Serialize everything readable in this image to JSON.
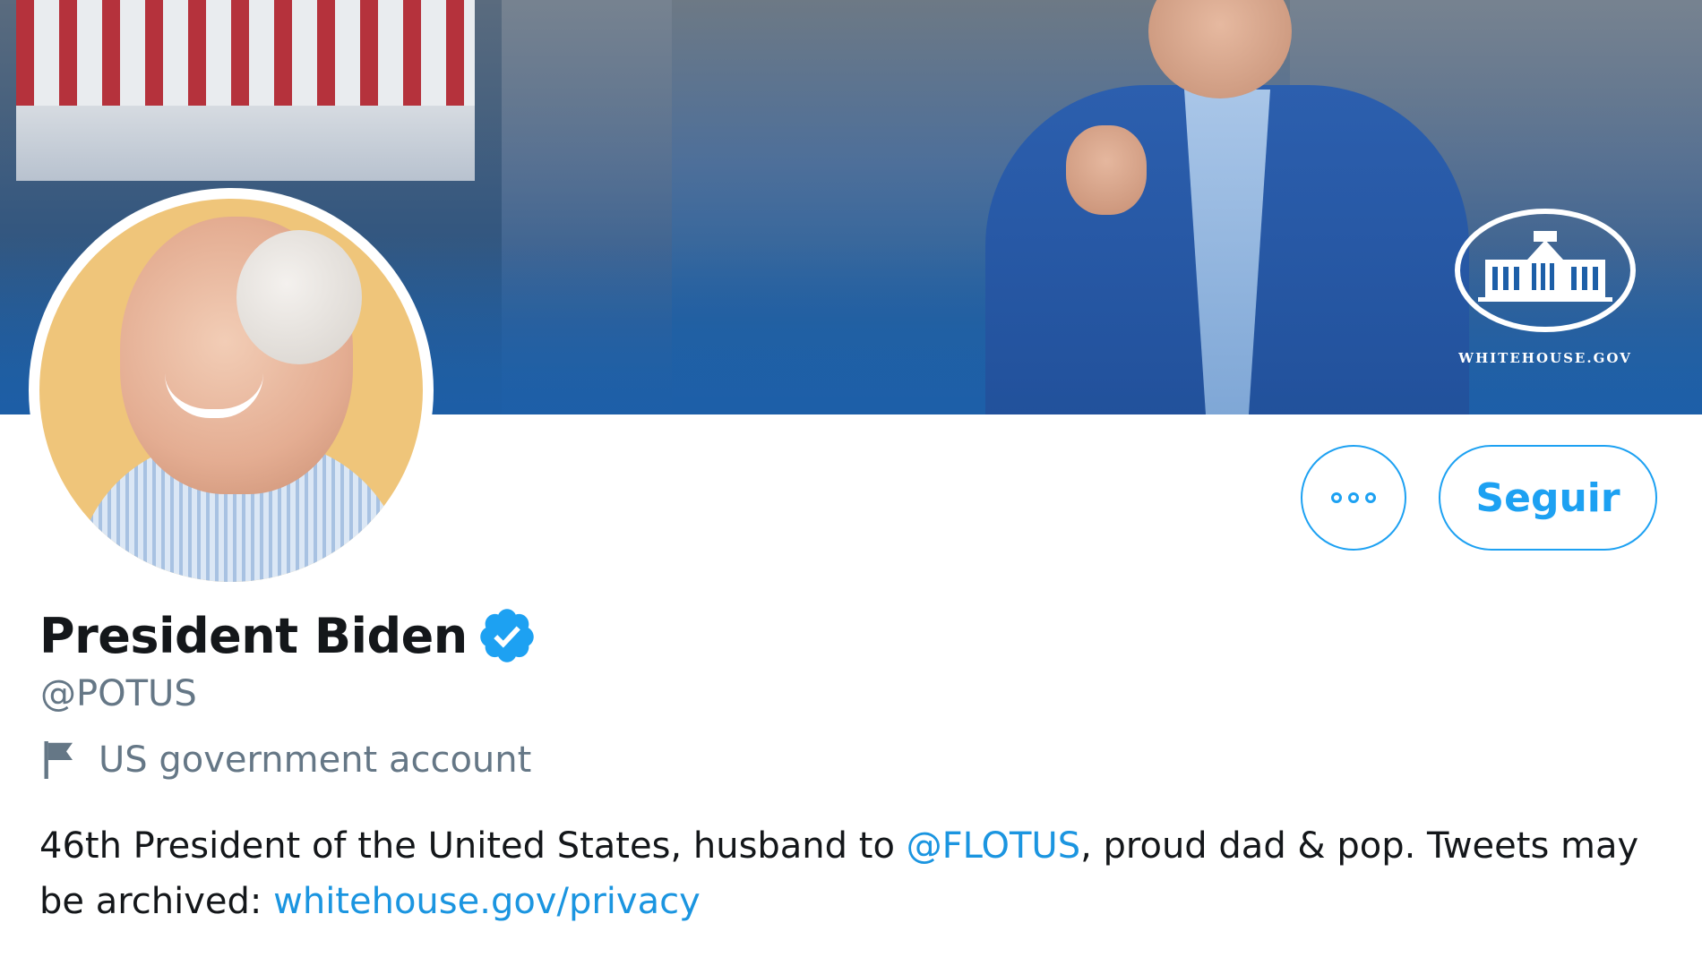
{
  "banner": {
    "logo_text": "WHITEHOUSE.GOV",
    "primary_color": "#1d5fa8"
  },
  "profile": {
    "display_name": "President Biden",
    "verified": true,
    "handle": "@POTUS",
    "account_label": "US government account",
    "account_label_icon": "flag-icon"
  },
  "actions": {
    "more_icon": "more-options-icon",
    "follow_label": "Seguir",
    "accent_color": "#1da1f2"
  },
  "bio": {
    "part1": "46th President of the United States, husband to ",
    "mention": "@FLOTUS",
    "part2": ", proud dad & pop. Tweets may be archived: ",
    "link": "whitehouse.gov/privacy"
  }
}
